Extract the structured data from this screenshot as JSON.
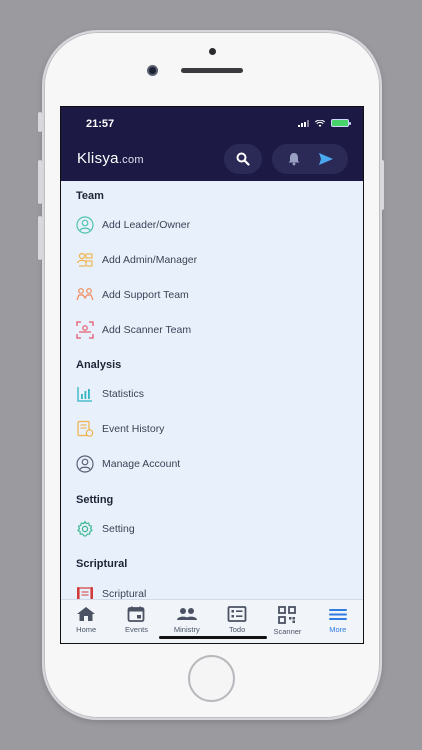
{
  "status": {
    "time": "21:57"
  },
  "header": {
    "brand_name": "Klisya",
    "brand_suffix": ".com"
  },
  "sections": {
    "team": {
      "title": "Team",
      "items": [
        {
          "label": "Add Leader/Owner",
          "icon": "user-add-icon",
          "color": "#4fc4b0"
        },
        {
          "label": "Add Admin/Manager",
          "icon": "admin-icon",
          "color": "#f0b24a"
        },
        {
          "label": "Add Support Team",
          "icon": "support-team-icon",
          "color": "#f08a5c"
        },
        {
          "label": "Add Scanner Team",
          "icon": "scanner-team-icon",
          "color": "#e5566a"
        }
      ]
    },
    "analysis": {
      "title": "Analysis",
      "items": [
        {
          "label": "Statistics",
          "icon": "bar-chart-icon",
          "color": "#2fb6c2"
        },
        {
          "label": "Event History",
          "icon": "event-history-icon",
          "color": "#f0b24a"
        },
        {
          "label": "Manage Account",
          "icon": "account-icon",
          "color": "#5a6176"
        }
      ]
    },
    "setting": {
      "title": "Setting",
      "items": [
        {
          "label": "Setting",
          "icon": "gear-icon",
          "color": "#35b58a"
        }
      ]
    },
    "scriptural": {
      "title": "Scriptural",
      "items": [
        {
          "label": "Scriptural",
          "icon": "scroll-icon",
          "color": "#d23c3c"
        }
      ]
    }
  },
  "bottom_nav": [
    {
      "label": "Home",
      "icon": "home-icon"
    },
    {
      "label": "Events",
      "icon": "calendar-icon"
    },
    {
      "label": "Ministry",
      "icon": "people-icon"
    },
    {
      "label": "Todo",
      "icon": "list-icon"
    },
    {
      "label": "Scanner",
      "icon": "qr-icon"
    },
    {
      "label": "More",
      "icon": "menu-icon",
      "active": true
    }
  ],
  "colors": {
    "header_bg": "#1c1a44",
    "screen_bg": "#e8f0fb",
    "accent": "#2f7ce0",
    "send_icon": "#4aa8f0"
  }
}
